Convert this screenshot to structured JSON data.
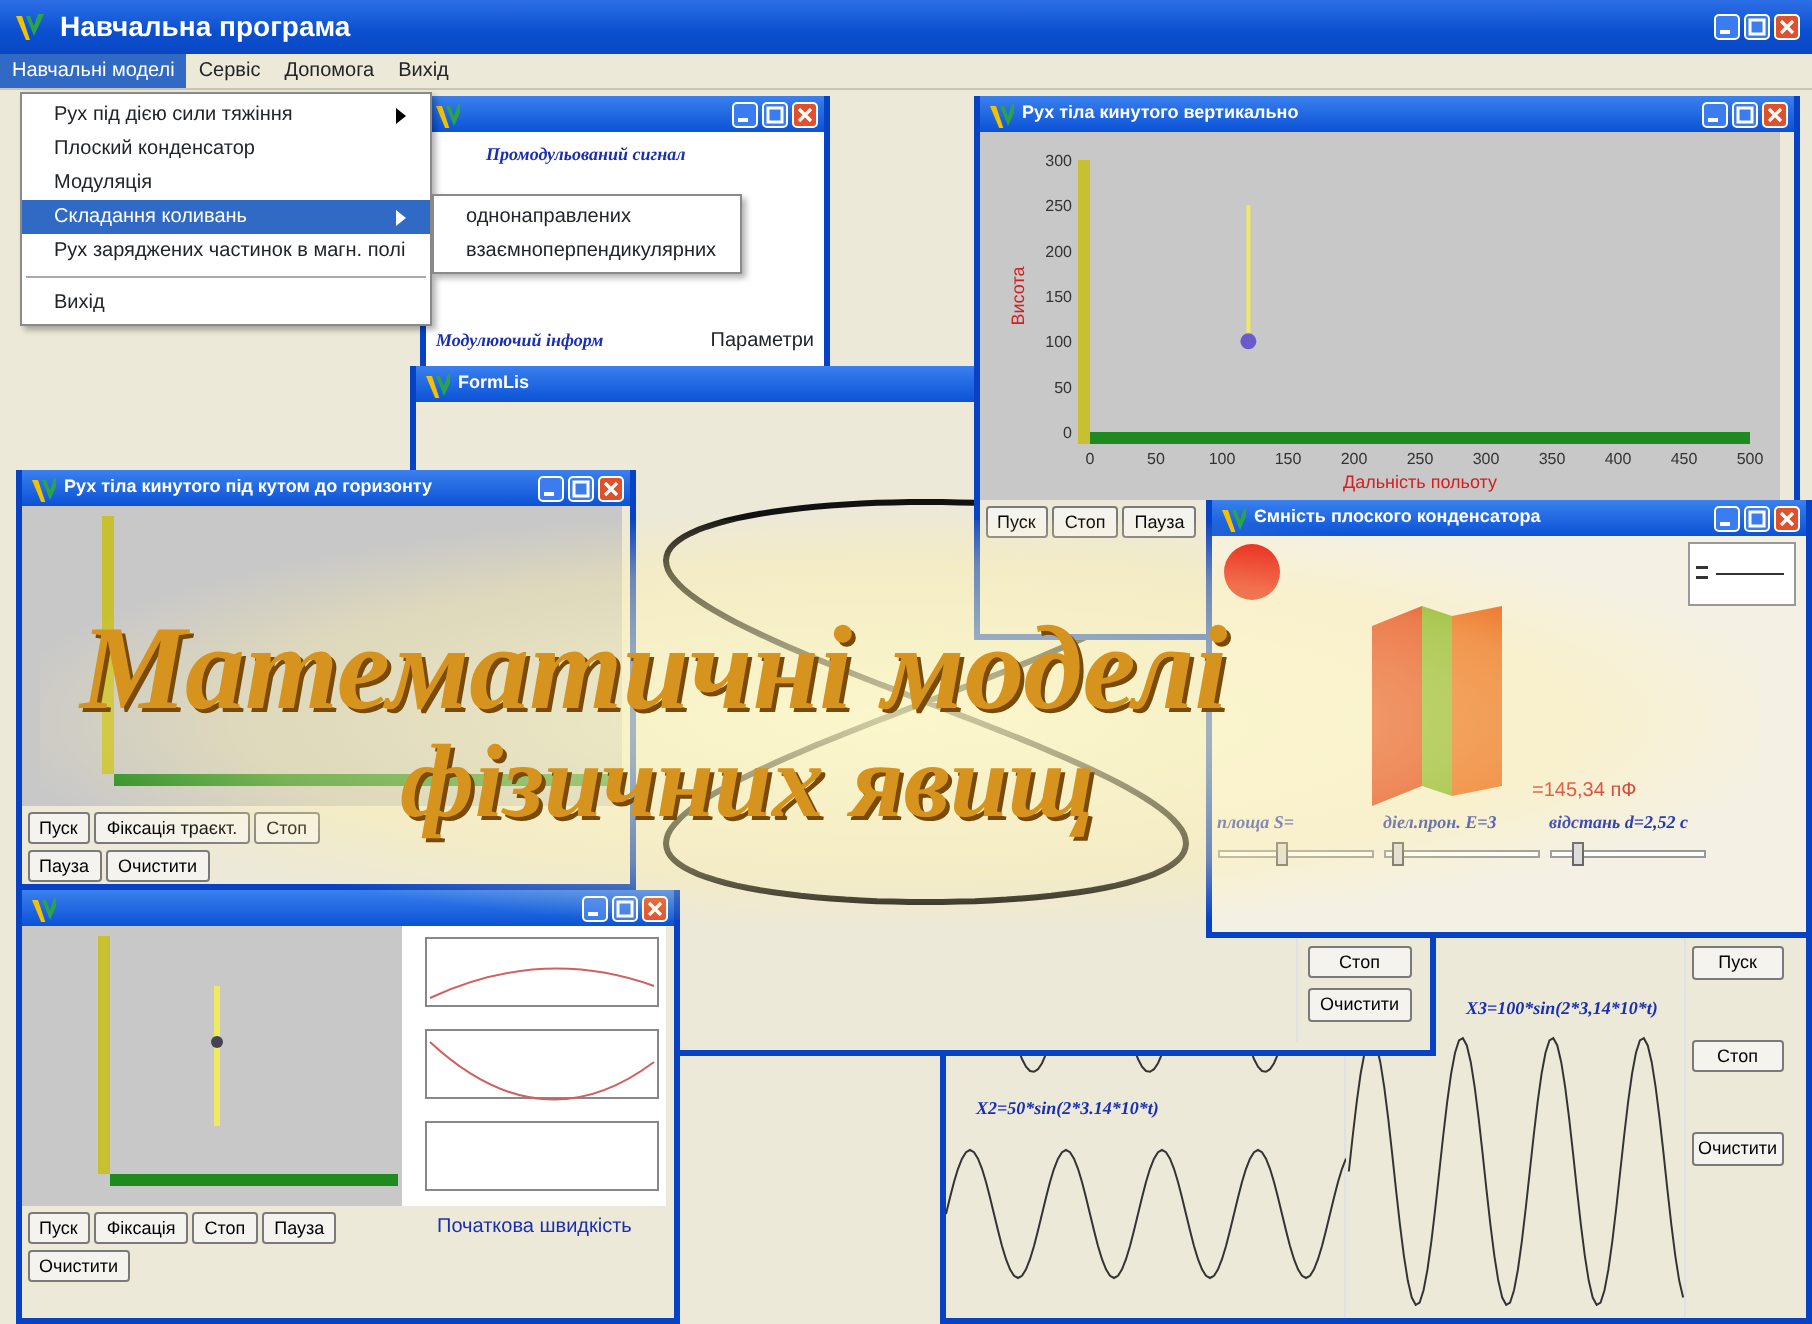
{
  "main_window": {
    "title": "Навчальна програма"
  },
  "menu_bar": [
    {
      "label": "Навчальні моделі",
      "selected": true
    },
    {
      "label": "Сервіс",
      "selected": false
    },
    {
      "label": "Допомога",
      "selected": false
    },
    {
      "label": "Вихід",
      "selected": false
    }
  ],
  "menu": [
    {
      "kind": "item",
      "label": "Рух під дією сили тяжіння",
      "submenu": true,
      "selected": false
    },
    {
      "kind": "item",
      "label": "Плоский конденсатор",
      "submenu": false,
      "selected": false
    },
    {
      "kind": "item",
      "label": "Модуляція",
      "submenu": false,
      "selected": false
    },
    {
      "kind": "item",
      "label": "Складання коливань",
      "submenu": true,
      "selected": true
    },
    {
      "kind": "item",
      "label": "Рух заряджених частинок в магн. полі",
      "submenu": false,
      "selected": false
    },
    {
      "kind": "separator"
    },
    {
      "kind": "item",
      "label": "Вихід",
      "submenu": false,
      "selected": false
    }
  ],
  "submenu": [
    {
      "label": "однонаправлених"
    },
    {
      "label": "взаємноперпендикулярних"
    }
  ],
  "windows": [
    {
      "kind": "sum",
      "texts": [
        "X2=50*sin(2*3.14*10*t)",
        "X3=100*sin(2*3,14*10*t)"
      ],
      "buttons": [
        "Пуск",
        "Стоп",
        "Очистити"
      ]
    },
    {
      "kind": "modulation",
      "texts": [
        "Промодульований сигнал",
        "Модулюючий інформ",
        "Параметри"
      ]
    },
    {
      "kind": "lissajous",
      "title": "FormLis",
      "buttons": [
        "Стоп",
        "Очистити"
      ]
    },
    {
      "kind": "vertical",
      "title": "Рух тіла кинутого вертикально",
      "buttons": [
        "Пуск",
        "Стоп",
        "Пауза"
      ],
      "chart_data": {
        "type": "scatter",
        "xlabel": "Дальність польоту",
        "ylabel": "Висота",
        "x": [
          120
        ],
        "series": [
          {
            "color": "#6a5acd",
            "values": [
              100
            ]
          }
        ],
        "xlim": [
          0,
          500
        ],
        "ylim": [
          0,
          300
        ],
        "xticks": [
          0,
          50,
          100,
          150,
          200,
          250,
          300,
          350,
          400,
          450,
          500
        ],
        "yticks": [
          0,
          50,
          100,
          150,
          200,
          250,
          300
        ]
      }
    },
    {
      "kind": "angle",
      "title": "Рух тіла кинутого під кутом до горизонту",
      "buttons": [
        "Пуск",
        "Фіксація траєкт.",
        "Стоп",
        "Пауза",
        "Очистити"
      ]
    },
    {
      "kind": "weight",
      "texts": [
        "Початкова швидкість"
      ],
      "buttons": [
        "Пуск",
        "Фіксація",
        "Стоп",
        "Пауза",
        "Очистити"
      ]
    },
    {
      "kind": "capacitor",
      "title": "Ємність плоского конденсатора",
      "texts": [
        "=145,34 пФ"
      ],
      "sliders": [
        {
          "label": "площа S=",
          "level": 0.4
        },
        {
          "label": "діел.прон. E=3",
          "level": 0.05
        },
        {
          "label": "відстань d=2,52 с",
          "level": 0.15
        }
      ]
    }
  ],
  "splash_title": [
    "Математичні моделі",
    "фізичних явищ"
  ]
}
